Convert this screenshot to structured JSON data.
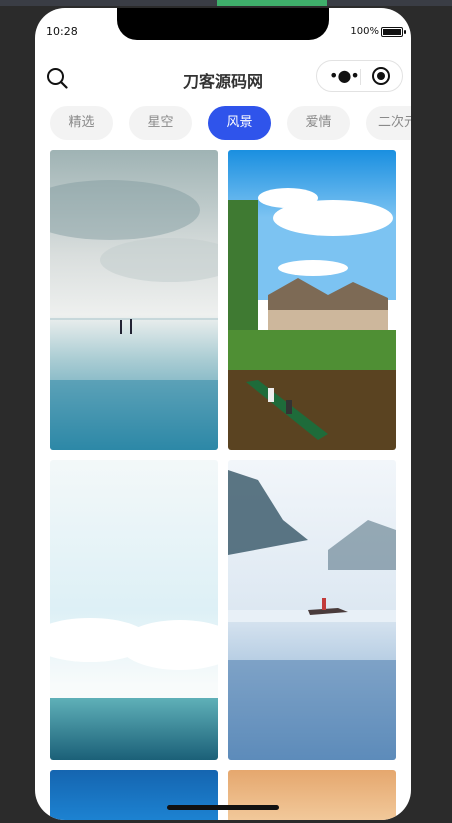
{
  "status_bar": {
    "time": "10:28",
    "battery": "100%"
  },
  "header": {
    "title": "刀客源码网",
    "search_icon": "search-icon",
    "more_icon": "more-dots-icon",
    "close_icon": "target-circle-icon"
  },
  "tabs": [
    {
      "label": "精选",
      "active": false
    },
    {
      "label": "星空",
      "active": false
    },
    {
      "label": "风景",
      "active": true
    },
    {
      "label": "爱情",
      "active": false
    },
    {
      "label": "二次元",
      "active": false
    }
  ],
  "wallpapers": [
    {
      "subject": "beach-reflection-image"
    },
    {
      "subject": "thatched-village-boat-image"
    },
    {
      "subject": "sea-clouds-image"
    },
    {
      "subject": "misty-lake-boat-image"
    },
    {
      "subject": "blue-sky-image"
    },
    {
      "subject": "sunset-sky-image"
    }
  ],
  "colors": {
    "accent": "#2f54eb",
    "tab_bg": "#f3f3f3",
    "tab_text": "#8a8a8a"
  }
}
